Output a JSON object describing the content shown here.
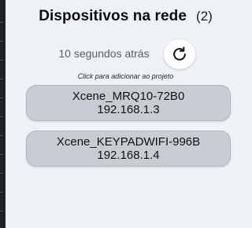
{
  "header": {
    "title": "Dispositivos na rede",
    "count": "(2)"
  },
  "refresh": {
    "timestamp": "10 segundos atrás",
    "icon": "refresh-icon"
  },
  "hint": "Click para adicionar ao projeto",
  "devices": [
    {
      "name": "Xcene_MRQ10-72B0",
      "ip": "192.168.1.3"
    },
    {
      "name": "Xcene_KEYPADWIFI-996B",
      "ip": "192.168.1.4"
    }
  ]
}
